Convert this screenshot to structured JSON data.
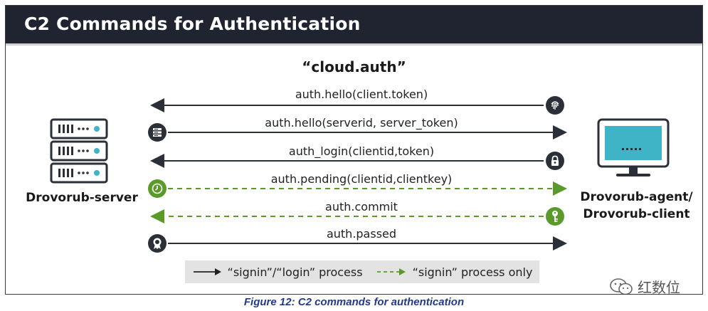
{
  "header": {
    "title": "C2 Commands for Authentication"
  },
  "diagram": {
    "title": "“cloud.auth”",
    "server_label": "Drovorub-server",
    "client_label_line1": "Drovorub-agent/",
    "client_label_line2": "Drovorub-client",
    "messages": [
      {
        "label": "auth.hello(client.token)",
        "direction": "to-server",
        "style": "solid",
        "icon": "fingerprint-icon"
      },
      {
        "label": "auth.hello(serverid, server_token)",
        "direction": "to-client",
        "style": "solid",
        "icon": "server-list-icon"
      },
      {
        "label": "auth_login(clientid,token)",
        "direction": "to-server",
        "style": "solid",
        "icon": "lock-icon"
      },
      {
        "label": "auth.pending(clientid,clientkey)",
        "direction": "to-client",
        "style": "dashed",
        "icon": "clock-icon"
      },
      {
        "label": "auth.commit",
        "direction": "to-server",
        "style": "dashed",
        "icon": "key-icon"
      },
      {
        "label": "auth.passed",
        "direction": "to-client",
        "style": "solid",
        "icon": "award-icon"
      }
    ],
    "legend": {
      "solid_label": "“signin”/“login” process",
      "dashed_label": "“signin” process only"
    },
    "colors": {
      "dark": "#2b2f38",
      "green": "#5a9a2a",
      "header": "#1f2430",
      "caption": "#233a8a"
    }
  },
  "caption": "Figure 12: C2 commands for authentication",
  "watermark": "红数位"
}
